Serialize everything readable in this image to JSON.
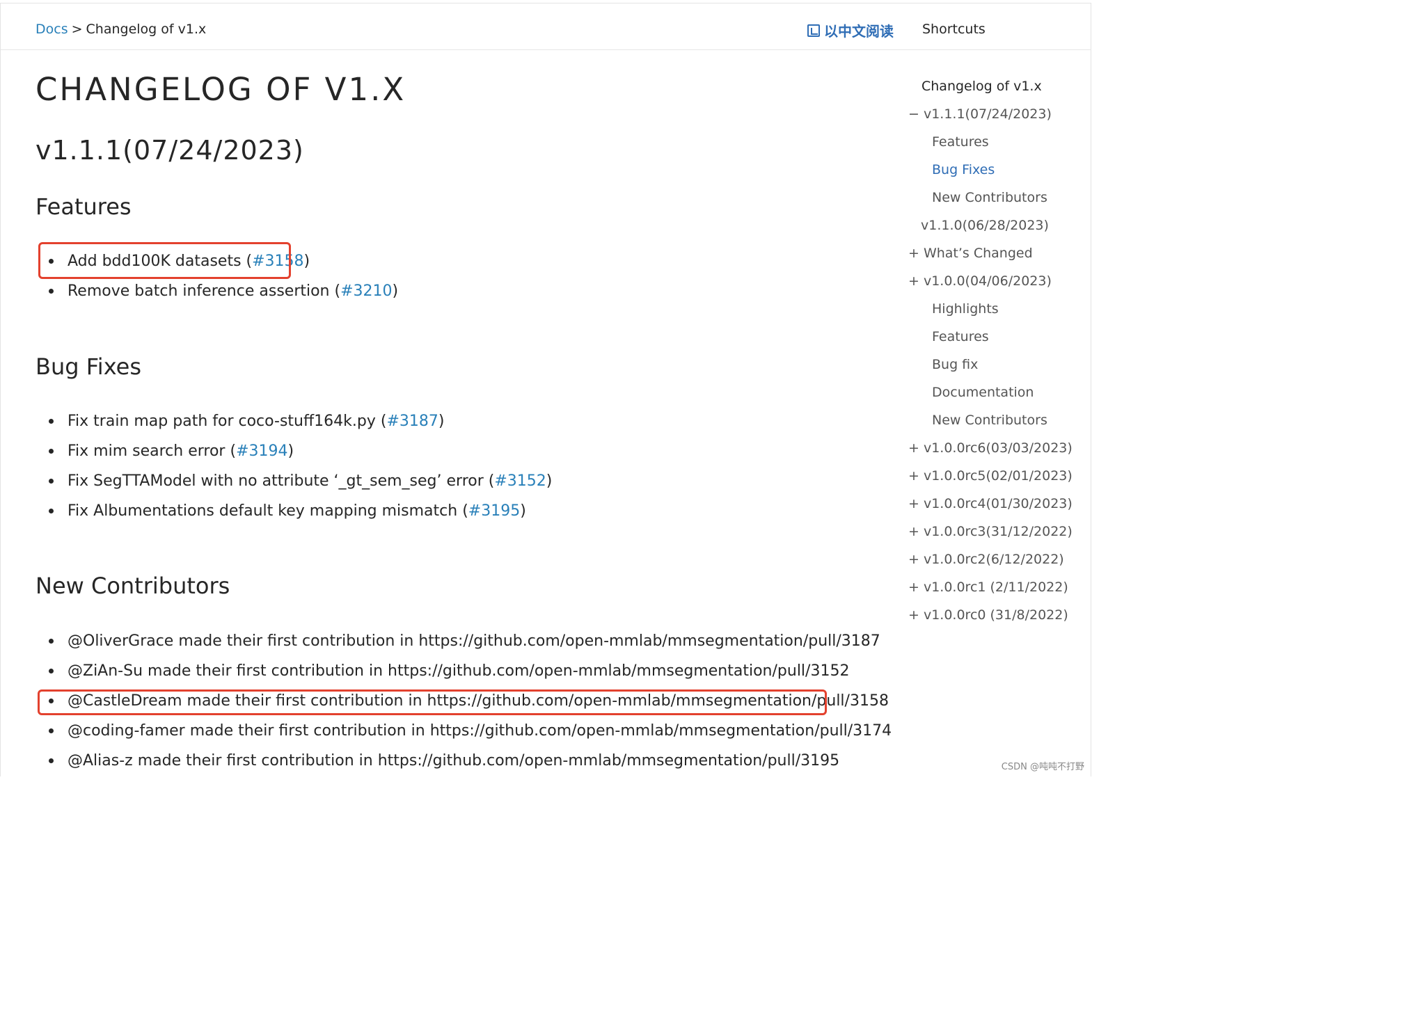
{
  "breadcrumb": {
    "docs": "Docs",
    "sep": ">",
    "current": "Changelog of v1.x"
  },
  "header": {
    "read_cn": "以中文阅读",
    "shortcuts": "Shortcuts"
  },
  "page": {
    "title": "CHANGELOG OF V1.X",
    "version_heading": "v1.1.1(07/24/2023)",
    "features_heading": "Features",
    "features": [
      {
        "text": "Add bdd100K datasets (",
        "link": "#3158",
        "end": ")"
      },
      {
        "text": "Remove batch inference assertion (",
        "link": "#3210",
        "end": ")"
      }
    ],
    "bugfixes_heading": "Bug Fixes",
    "bugfixes": [
      {
        "text": "Fix train map path for coco-stuff164k.py (",
        "link": "#3187",
        "end": ")"
      },
      {
        "text": "Fix mim search error (",
        "link": "#3194",
        "end": ")"
      },
      {
        "text": "Fix SegTTAModel with no attribute ‘_gt_sem_seg’ error (",
        "link": "#3152",
        "end": ")"
      },
      {
        "text": "Fix Albumentations default key mapping mismatch (",
        "link": "#3195",
        "end": ")"
      }
    ],
    "contributors_heading": "New Contributors",
    "contributors": [
      "@OliverGrace made their first contribution in https://github.com/open-mmlab/mmsegmentation/pull/3187",
      "@ZiAn-Su made their first contribution in https://github.com/open-mmlab/mmsegmentation/pull/3152",
      "@CastleDream made their first contribution in https://github.com/open-mmlab/mmsegmentation/pull/3158",
      "@coding-famer made their first contribution in https://github.com/open-mmlab/mmsegmentation/pull/3174",
      "@Alias-z made their first contribution in https://github.com/open-mmlab/mmsegmentation/pull/3195"
    ]
  },
  "toc": {
    "title": "Changelog of v1.x",
    "items": [
      "− v1.1.1(07/24/2023)",
      "Features",
      "Bug Fixes",
      "New Contributors",
      "v1.1.0(06/28/2023)",
      "+ What’s Changed",
      "+ v1.0.0(04/06/2023)",
      "Highlights",
      "Features",
      "Bug fix",
      "Documentation",
      "New Contributors",
      "+ v1.0.0rc6(03/03/2023)",
      "+ v1.0.0rc5(02/01/2023)",
      "+ v1.0.0rc4(01/30/2023)",
      "+ v1.0.0rc3(31/12/2022)",
      "+ v1.0.0rc2(6/12/2022)",
      "+ v1.0.0rc1 (2/11/2022)",
      "+ v1.0.0rc0 (31/8/2022)"
    ]
  },
  "watermark": "CSDN @吨吨不打野",
  "colors": {
    "link": "#2980b9",
    "highlight": "#e3412e",
    "text": "#262626"
  }
}
